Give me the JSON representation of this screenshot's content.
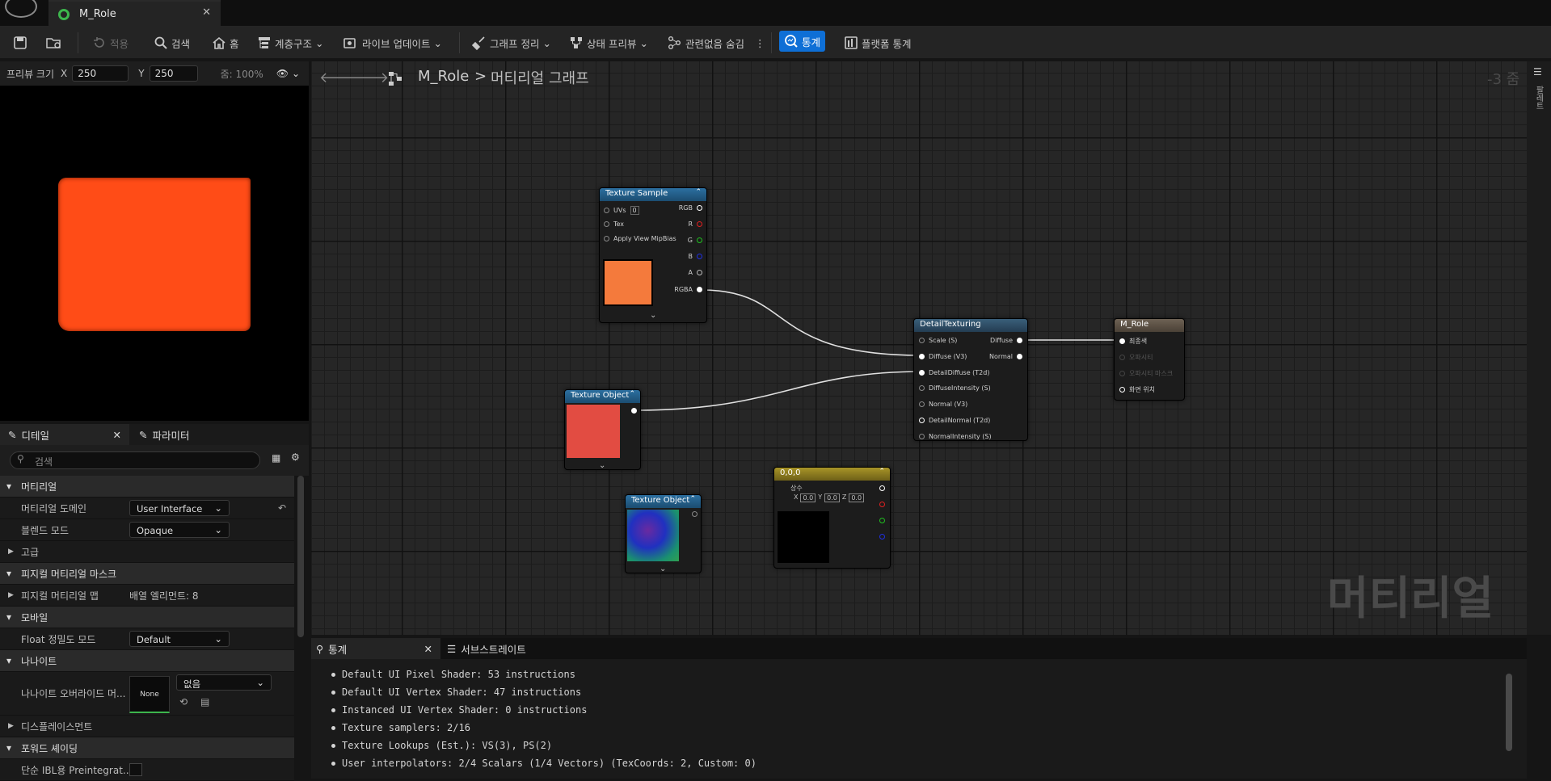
{
  "window": {
    "tab_title": "M_Role"
  },
  "toolbar": {
    "apply": "적용",
    "search": "검색",
    "home": "홈",
    "hierarchy": "계층구조",
    "live_update": "라이브 업데이트",
    "graph_cleanup": "그래프 정리",
    "state_preview": "상태 프리뷰",
    "hide_unrelated": "관련없음 숨김",
    "stats": "통계",
    "platform_stats": "플랫폼 통계"
  },
  "preview": {
    "size_label": "프리뷰 크기",
    "x_label": "X",
    "x_value": "250",
    "y_label": "Y",
    "y_value": "250",
    "zoom": "줌: 100%",
    "swatch_color": "#ff4c17"
  },
  "details": {
    "tab_details": "디테일",
    "tab_params": "파라미터",
    "search_placeholder": "검색",
    "cat_material": "머티리얼",
    "domain_label": "머티리얼 도메인",
    "domain_value": "User Interface",
    "blend_label": "블렌드 모드",
    "blend_value": "Opaque",
    "cat_advanced": "고급",
    "cat_physical_mask": "피지컬 머티리얼 마스크",
    "physmap_label": "피지컬 머티리얼 맵",
    "physmap_value": "배열 엘리먼트: 8",
    "cat_mobile": "모바일",
    "float_label": "Float 정밀도 모드",
    "float_value": "Default",
    "cat_nanite": "나나이트",
    "nanite_label": "나나이트 오버라이드 머...",
    "nanite_thumb": "None",
    "nanite_value": "없음",
    "cat_displacement": "디스플레이스먼트",
    "cat_forward": "포워드 셰이딩",
    "ibl_label": "단순 IBL용 Preintegrat..."
  },
  "graph": {
    "breadcrumb_root": "M_Role",
    "breadcrumb_sep": ">",
    "breadcrumb_leaf": "머티리얼 그래프",
    "zoom": "-3 줌",
    "watermark": "머티리얼",
    "nodes": {
      "texture_sample": {
        "title": "Texture Sample",
        "uvs": "UVs",
        "uvs_val": "0",
        "tex": "Tex",
        "mip": "Apply View MipBias",
        "out_rgb": "RGB",
        "out_r": "R",
        "out_g": "G",
        "out_b": "B",
        "out_a": "A",
        "out_rgba": "RGBA",
        "color": "#f47a3c"
      },
      "texture_object_1": {
        "title": "Texture Object",
        "color": "#e24c42"
      },
      "texture_object_2": {
        "title": "Texture Object"
      },
      "constant": {
        "title": "0,0,0",
        "sub": "상수",
        "x": "X",
        "xv": "0.0",
        "y": "Y",
        "yv": "0.0",
        "z": "Z",
        "zv": "0.0"
      },
      "detail": {
        "title": "DetailTexturing",
        "scale": "Scale (S)",
        "diffuse": "Diffuse (V3)",
        "detail_diffuse": "DetailDiffuse (T2d)",
        "diffuse_int": "DiffuseIntensity (S)",
        "normal": "Normal (V3)",
        "detail_normal": "DetailNormal (T2d)",
        "normal_int": "NormalIntensity (S)",
        "out_diffuse": "Diffuse",
        "out_normal": "Normal"
      },
      "result": {
        "title": "M_Role",
        "p1": "최종색",
        "p2": "오파시티",
        "p3": "오파시티 마스크",
        "p4": "화면 위치"
      }
    }
  },
  "right_strip": {
    "label": "팔레트"
  },
  "stats": {
    "tab_stats": "통계",
    "tab_substrate": "서브스트레이트",
    "lines": [
      "Default UI Pixel Shader: 53 instructions",
      "Default UI Vertex Shader: 47 instructions",
      "Instanced UI Vertex Shader: 0 instructions",
      "Texture samplers: 2/16",
      "Texture Lookups (Est.): VS(3), PS(2)",
      "User interpolators: 2/4 Scalars (1/4 Vectors) (TexCoords: 2, Custom: 0)"
    ]
  }
}
